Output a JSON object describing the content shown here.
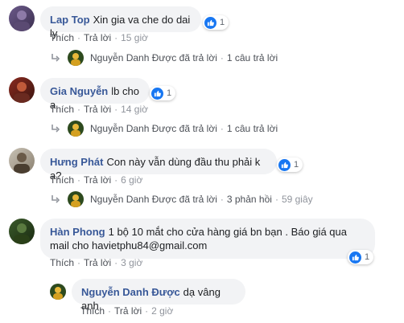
{
  "colors": {
    "link": "#385898",
    "bubble": "#f2f3f5",
    "like": "#1877f2"
  },
  "actions": {
    "like": "Thích",
    "reply": "Trả lời",
    "sep": "·"
  },
  "comments": [
    {
      "author": "Lap Top",
      "text": "Xin gia va che do dai ly",
      "likes": "1",
      "time": "15 giờ",
      "reply_summary": {
        "name": "Nguyễn Danh Được",
        "replied": "đã trả lời",
        "count": "1 câu trả lời"
      }
    },
    {
      "author": "Gia Nguyễn",
      "text": "lb cho a",
      "likes": "1",
      "time": "14 giờ",
      "reply_summary": {
        "name": "Nguyễn Danh Được",
        "replied": "đã trả lời",
        "count": "1 câu trả lời"
      }
    },
    {
      "author": "Hưng Phát",
      "text": "Con này vẫn dùng đầu thu phải k a?",
      "likes": "1",
      "time": "6 giờ",
      "reply_summary": {
        "name": "Nguyễn Danh Được",
        "replied": "đã trả lời",
        "count": "3 phản hồi",
        "time": "59 giây"
      }
    },
    {
      "author": "Hàn Phong",
      "text_line1": "1 bộ 10 mắt cho cửa hàng giá bn bạn . Báo giá qua",
      "text_line2": "mail cho havietphu84@gmail.com",
      "likes": "1",
      "time": "3 giờ"
    }
  ],
  "reply": {
    "author": "Nguyễn Danh Được",
    "text": "dạ vâng anh",
    "time": "2 giờ"
  }
}
